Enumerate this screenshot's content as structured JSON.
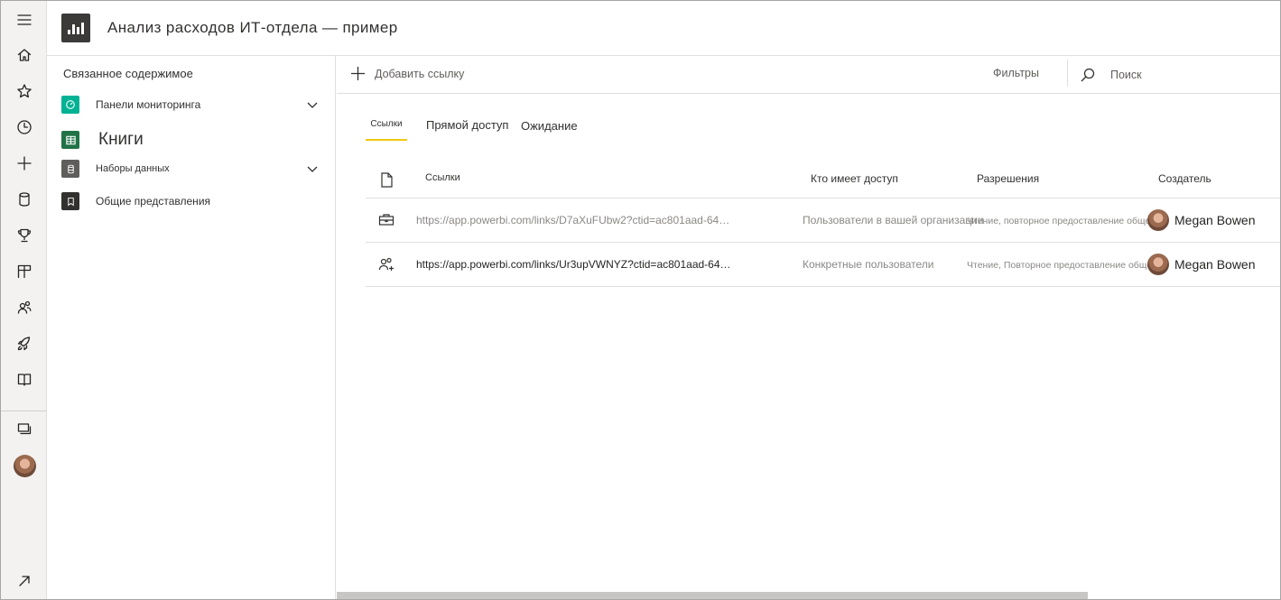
{
  "header": {
    "title": "Анализ расходов ИТ-отдела — пример",
    "logo_icon": "report-chart-icon"
  },
  "rail": {
    "items": [
      {
        "name": "menu-icon"
      },
      {
        "name": "home-icon"
      },
      {
        "name": "favorites-star-icon"
      },
      {
        "name": "recent-clock-icon"
      },
      {
        "name": "create-plus-icon"
      },
      {
        "name": "datasets-cylinder-icon"
      },
      {
        "name": "goals-trophy-icon"
      },
      {
        "name": "apps-icon"
      },
      {
        "name": "shared-people-icon"
      },
      {
        "name": "learn-rocket-icon"
      },
      {
        "name": "workspaces-book-icon"
      },
      {
        "name": "workspace-stack-icon"
      },
      {
        "name": "expand-arrow-icon"
      }
    ]
  },
  "nav": {
    "header": "Связанное содержимое",
    "items": [
      {
        "label": "Панели мониторинга",
        "icon": "dashboard-icon",
        "color": "#00b294",
        "expandable": true
      },
      {
        "label": "Книги",
        "icon": "excel-workbook-icon",
        "color": "#217346",
        "expandable": false
      },
      {
        "label": "Наборы данных",
        "icon": "dataset-icon",
        "color": "#605e5c",
        "expandable": true
      },
      {
        "label": "Общие представления",
        "icon": "bookmark-icon",
        "color": "#323130",
        "expandable": false
      }
    ]
  },
  "toolbar": {
    "add_link_label": "Добавить ссылку",
    "filters_label": "Фильтры",
    "search_placeholder": "Поиск"
  },
  "tabs": [
    {
      "label": "Ссылки",
      "active": true
    },
    {
      "label": "Прямой доступ",
      "active": false
    },
    {
      "label": "Ожидание",
      "active": false
    }
  ],
  "table": {
    "columns": [
      "Ссылки",
      "Кто имеет доступ",
      "Разрешения",
      "Создатель"
    ],
    "rows": [
      {
        "icon": "organization-briefcase-icon",
        "link": "https://app.powerbi.com/links/D7aXuFUbw2?ctid=ac801aad-64…",
        "access": "Пользователи в вашей организации",
        "permissions": "Чтение, повторное предоставление общего",
        "creator": "Megan Bowen"
      },
      {
        "icon": "specific-people-icon",
        "link": "https://app.powerbi.com/links/Ur3upVWNYZ?ctid=ac801aad-64…",
        "access": "Конкретные пользователи",
        "permissions": "Чтение, Повторное предоставление общего",
        "creator": "Megan Bowen"
      }
    ]
  },
  "colors": {
    "accent_tab_underline": "#f2c811",
    "rail_background": "#f3f2f1",
    "divider": "#e1dfdd"
  }
}
